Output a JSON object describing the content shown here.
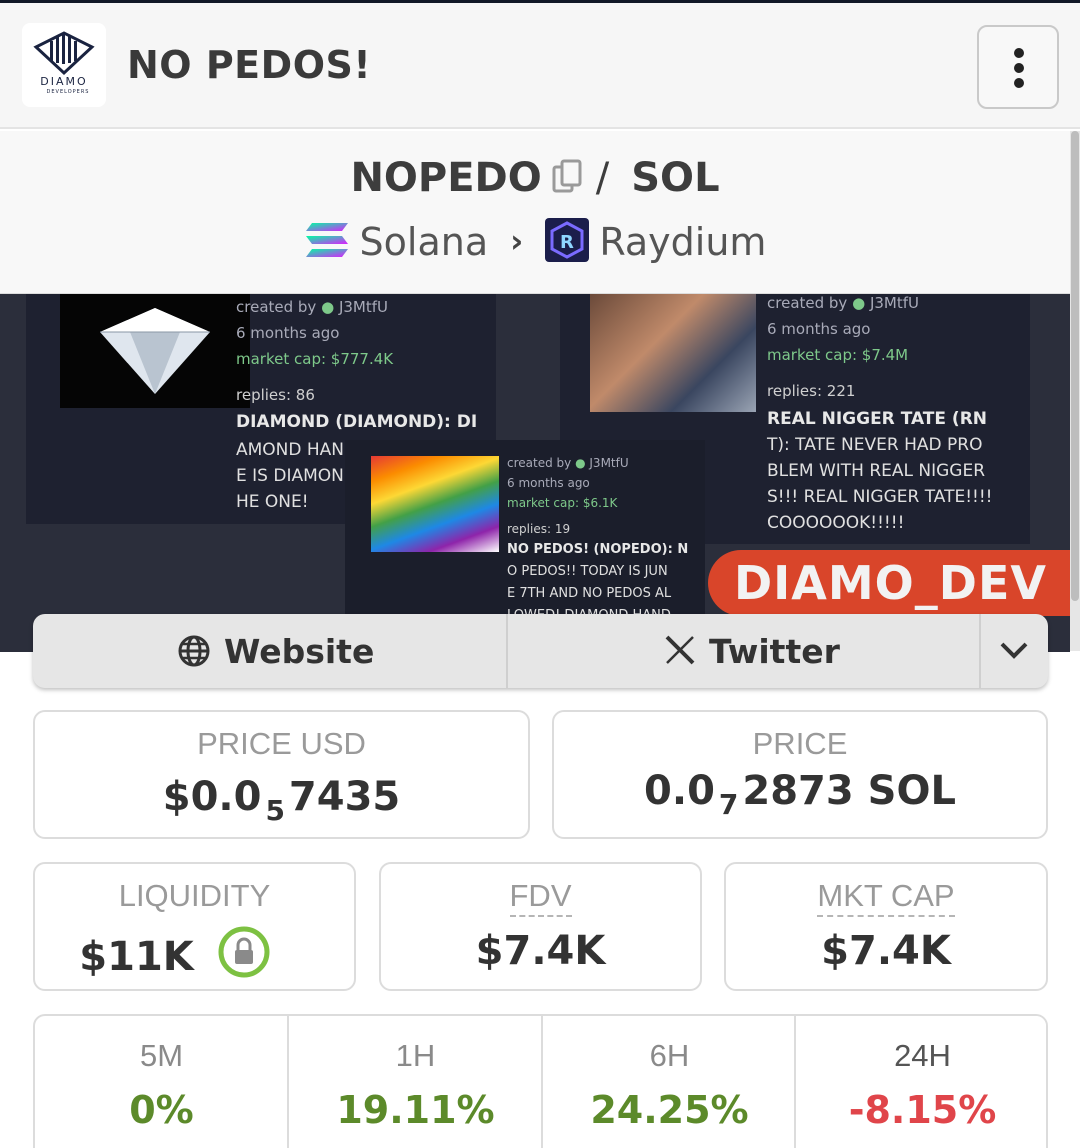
{
  "header": {
    "logo_main": "DIAMO",
    "logo_sub": "DEVELOPERS",
    "title": "NO PEDOS!",
    "menu_icon": "more-vertical-icon"
  },
  "pair": {
    "base": "NOPEDO",
    "separator": "/",
    "quote": "SOL",
    "chain": "Solana",
    "dex": "Raydium"
  },
  "banner": {
    "card1": {
      "created": "created by",
      "user": "J3MtfU",
      "age": "6 months ago",
      "cap": "market cap: $777.4K",
      "replies": "replies: 86",
      "line1": "DIAMOND (DIAMOND): DI",
      "line2": "AMOND HAN",
      "line3": "E IS DIAMON",
      "line4": "HE ONE!"
    },
    "card2": {
      "created": "created by",
      "user": "J3MtfU",
      "age": "6 months ago",
      "cap": "market cap: $7.4M",
      "replies": "replies: 221",
      "line1": "REAL NIGGER TATE (RN",
      "line2": "T): TATE NEVER HAD PRO",
      "line3": "BLEM WITH REAL NIGGER",
      "line4": "S!!! REAL NIGGER TATE!!!!",
      "line5": "COOOOOOK!!!!!"
    },
    "card3": {
      "created": "created by",
      "user": "J3MtfU",
      "age": "6 months ago",
      "cap": "market cap: $6.1K",
      "replies": "replies: 19",
      "line1": "NO PEDOS! (NOPEDO): N",
      "line2": "O PEDOS!! TODAY IS JUN",
      "line3": "E 7TH AND NO PEDOS AL",
      "line4": "LOWED! DIAMOND HAND"
    },
    "tag": "DIAMO_DEV"
  },
  "links": {
    "website": "Website",
    "twitter": "Twitter"
  },
  "stats": {
    "price_usd_label": "PRICE USD",
    "price_usd_prefix": "$0.0",
    "price_usd_sub": "5",
    "price_usd_rest": "7435",
    "price_label": "PRICE",
    "price_prefix": "0.0",
    "price_sub": "7",
    "price_rest": "2873 SOL",
    "liquidity_label": "LIQUIDITY",
    "liquidity_value": "$11K",
    "fdv_label": "FDV",
    "fdv_value": "$7.4K",
    "mktcap_label": "MKT CAP",
    "mktcap_value": "$7.4K"
  },
  "changes": [
    {
      "label": "5M",
      "value": "0%",
      "color": "#5c8a2a"
    },
    {
      "label": "1H",
      "value": "19.11%",
      "color": "#5c8a2a"
    },
    {
      "label": "6H",
      "value": "24.25%",
      "color": "#5c8a2a"
    },
    {
      "label": "24H",
      "value": "-8.15%",
      "color": "#e0454a"
    }
  ],
  "colors": {
    "positive": "#5c8a2a",
    "negative": "#e0454a",
    "lock_ring": "#7dc142"
  }
}
